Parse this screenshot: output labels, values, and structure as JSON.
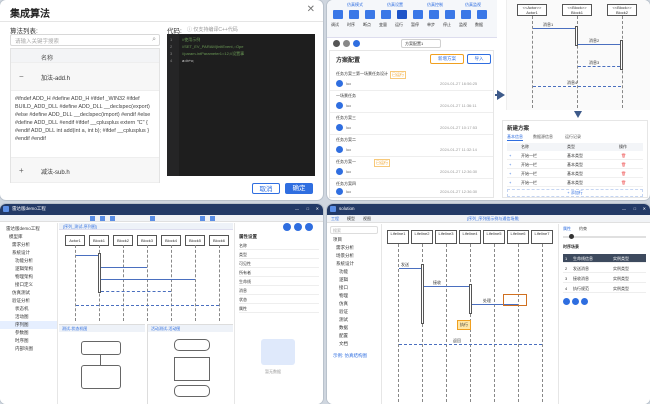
{
  "p1": {
    "title": "集成算法",
    "list_label": "算法列表:",
    "search_placeholder": "请输入关键字搜索",
    "col_name": "名称",
    "item1": "加法-add.h",
    "item1_code": "#ifndef ADD_H #define ADD_H #ifdef _WIN32 #ifdef BUILD_ADD_DLL #define ADD_DLL __declspec(export) #else #define ADD_DLL __declspec(import) #endif #else #define ADD_DLL #endif #ifdef __cplusplus extern \"C\" { #endif ADD_DLL int add(int a, int b); #ifdef __cplusplus } #endif #endif",
    "item2": "减法-sub.h",
    "collapse_sym": "−",
    "expand_sym": "+",
    "code_label": "代码:",
    "code_hint": "ⓘ 仅支持编译C++代码",
    "code_lines": [
      "//使用示例",
      "//SET_EV_PARAM(InitEvent,::Ope",
      "//param-intParameter1=12;//设置事",
      "a=b+c;"
    ],
    "line_nums": [
      "1",
      "2",
      "3",
      "4"
    ],
    "cancel": "取消",
    "ok": "确定"
  },
  "p2": {
    "ribbon_tabs": [
      "仿真模式",
      "仿真设置",
      "仿真控制",
      "仿真监视"
    ],
    "tool_labels": [
      "调试",
      "时序",
      "断点",
      "变量",
      "运行",
      "暂停",
      "单步",
      "停止",
      "监视",
      "数据"
    ],
    "plan_title": "方案配置",
    "select_value": "方案配置1",
    "btn_add_plan": "新增方案",
    "btn_import": "导入",
    "list": [
      {
        "title": "任务方案三第一场景任务设计",
        "tag": "已运行",
        "user": "luo",
        "date": "2024-01-27 16:56:25"
      },
      {
        "title": "一场景任务",
        "tag": "",
        "user": "luo",
        "date": "2024-01-27 11:36:11"
      },
      {
        "title": "任务方案三",
        "tag": "",
        "user": "luo",
        "date": "2024-01-27 10:17:53"
      },
      {
        "title": "任务方案二",
        "tag": "",
        "user": "luo",
        "date": "2024-01-27 11:32:14"
      },
      {
        "title": "任务方案一",
        "tag": "已运行",
        "user": "luo",
        "date": "2024-01-27 12:36:30"
      },
      {
        "title": "任务方案四",
        "tag": "",
        "user": "luo",
        "date": "2024-01-27 12:36:30"
      }
    ],
    "lane_labels": [
      "<<Actor>>",
      "<<Block>>",
      "<<Block>>"
    ],
    "lane_names": [
      "Actor1",
      "Block1",
      "Block2"
    ],
    "msg_labels": [
      "消息1",
      "消息2",
      "消息3",
      "消息4"
    ],
    "detail_title": "新建方案",
    "detail_tabs": [
      "基本信息",
      "数据源信息",
      "运行记录"
    ],
    "table_headers": [
      "名称",
      "类型",
      "操作"
    ],
    "table_rows": [
      {
        "name": "开始一栏",
        "type": "基本类型"
      },
      {
        "name": "开始一栏",
        "type": "基本类型"
      },
      {
        "name": "开始一栏",
        "type": "基本类型"
      },
      {
        "name": "开始一栏",
        "type": "基本类型"
      }
    ],
    "add_row": "+ 添加行"
  },
  "p3": {
    "title": "雷达版demo工程",
    "tab_main": "[序列_测试-序列图]",
    "panel_right_title": "属性设置",
    "props": [
      "名称",
      "类型",
      "可见性",
      "所有者",
      "生命线",
      "消息",
      "状态",
      "属性"
    ],
    "sub_tab1": "测试-状态机图",
    "sub_tab2": "活动测试-活动图",
    "no_data": "暂无数据",
    "tree": [
      "雷达版demo工程",
      "模型库",
      "需求分析",
      "系统设计",
      "功能分析",
      "逻辑架构",
      "物理架构",
      "接口定义",
      "仿真测试",
      "验证分析",
      "状态机",
      "活动图",
      "序列图",
      "参数图",
      "时序图",
      "内部块图"
    ],
    "lane_names": [
      "Actor1",
      "Block1",
      "Block2",
      "Block3",
      "Block4",
      "Block5",
      "Block6"
    ]
  },
  "p4": {
    "title": "solution",
    "tabs_left": [
      "工程",
      "模型",
      "视图"
    ],
    "tab_center": "[序列_序列图示例与通信场景]",
    "search_placeholder": "搜索",
    "right_tabs": [
      "属性",
      "约束"
    ],
    "right_title": "时序场景",
    "table_rows": [
      {
        "n": "1",
        "a": "生命线信息",
        "b": "实例类型"
      },
      {
        "n": "2",
        "a": "发送消息",
        "b": "实例类型"
      },
      {
        "n": "3",
        "a": "接收消息",
        "b": "实例类型"
      },
      {
        "n": "4",
        "a": "执行规范",
        "b": "实例类型"
      }
    ],
    "tree": [
      "项目",
      "需求分析",
      "场景分析",
      "系统设计",
      "功能",
      "逻辑",
      "接口",
      "物理",
      "仿真",
      "验证",
      "测试",
      "数据",
      "配置",
      "文档",
      "示例: 仿真结构图"
    ],
    "lane_names": [
      "Lifeline1",
      "Lifeline2",
      "Lifeline3",
      "Lifeline4",
      "Lifeline5",
      "Lifeline6",
      "Lifeline7"
    ],
    "msg_labels": [
      "发送",
      "接收",
      "处理",
      "返回"
    ],
    "badge": "执行"
  },
  "colors": {
    "primary": "#2f6ee0",
    "accent_orange": "#f0a020",
    "code_bg": "#1e1e1e"
  }
}
